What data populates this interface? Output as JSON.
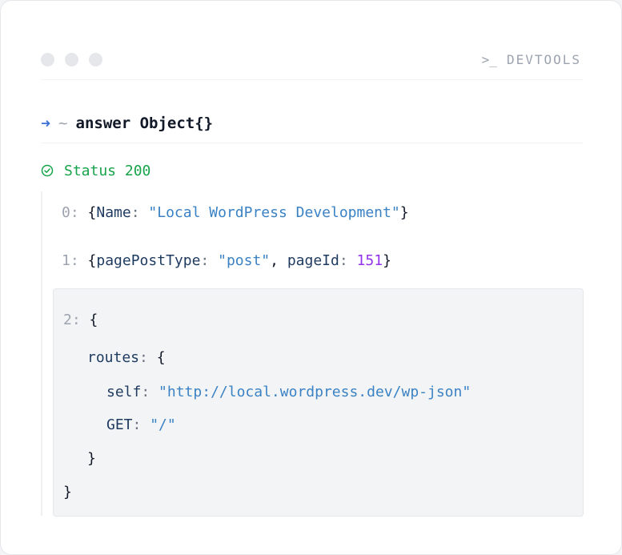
{
  "header": {
    "prompt_icon": ">_",
    "label": "DEVTOOLS"
  },
  "command": {
    "arrow": "➜",
    "tilde": "~",
    "text": "answer Object{}"
  },
  "status": {
    "text": "Status 200",
    "color": "#16a34a"
  },
  "items": [
    {
      "index": "0:",
      "open": "{",
      "key": "Name",
      "colon": ":",
      "value": "\"Local WordPress Development\"",
      "close": "}"
    },
    {
      "index": "1:",
      "open": "{",
      "key1": "pagePostType",
      "colon1": ":",
      "value1": "\"post\"",
      "comma": ",",
      "key2": "pageId",
      "colon2": ":",
      "value2": "151",
      "close": "}"
    },
    {
      "index": "2:",
      "open": "{",
      "routes_key": "routes",
      "routes_colon": ":",
      "routes_open": "{",
      "self_key": "self",
      "self_colon": ":",
      "self_value": "\"http://local.wordpress.dev/wp-json\"",
      "get_key": "GET",
      "get_colon": ":",
      "get_value": "\"/\"",
      "routes_close": "}",
      "close": "}"
    }
  ],
  "colors": {
    "key": "#1e3a5f",
    "string": "#3b82c4",
    "number": "#9333ea",
    "index": "#9ca3af",
    "arrow": "#3b6fd4"
  }
}
